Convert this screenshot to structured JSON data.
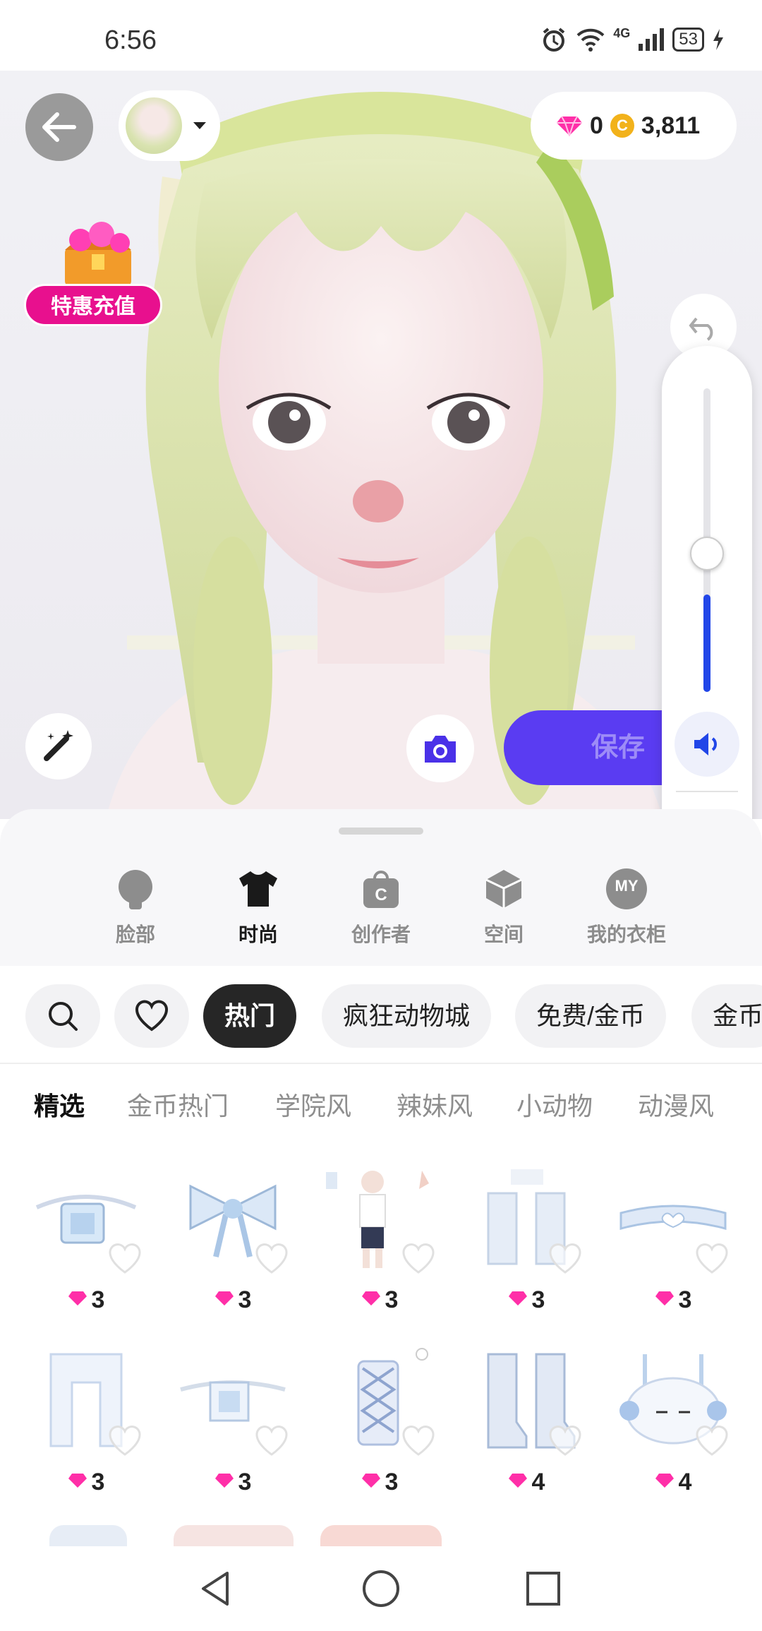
{
  "status_bar": {
    "time": "6:56",
    "network": "4G",
    "battery": "53"
  },
  "header": {
    "gems": "0",
    "coins": "3,811"
  },
  "promo": {
    "label": "特惠充值"
  },
  "actions": {
    "save_label": "保存"
  },
  "categories": [
    {
      "label": "脸部",
      "icon": "face-icon",
      "active": false
    },
    {
      "label": "时尚",
      "icon": "tshirt-icon",
      "active": true
    },
    {
      "label": "创作者",
      "icon": "creator-bag-icon",
      "active": false
    },
    {
      "label": "空间",
      "icon": "space-cube-icon",
      "active": false
    },
    {
      "label": "我的衣柜",
      "icon": "my-closet-icon",
      "active": false
    }
  ],
  "closet_icon_text": "MY",
  "filter_chips": [
    "热门",
    "疯狂动物城",
    "免费/金币",
    "金币"
  ],
  "sub_tabs": [
    "精选",
    "金币热门",
    "学院风",
    "辣妹风",
    "小动物",
    "动漫风"
  ],
  "items": [
    {
      "name": "lace-choker",
      "price": "3"
    },
    {
      "name": "blue-bow",
      "price": "3"
    },
    {
      "name": "full-outfit-set",
      "price": "3"
    },
    {
      "name": "white-leg-warmers",
      "price": "3"
    },
    {
      "name": "heart-choker",
      "price": "3"
    },
    {
      "name": "white-ruffle-top",
      "price": "3"
    },
    {
      "name": "frill-choker",
      "price": "3"
    },
    {
      "name": "lace-up-corset",
      "price": "3"
    },
    {
      "name": "white-boots",
      "price": "4"
    },
    {
      "name": "bunny-earmuffs",
      "price": "4"
    }
  ],
  "colors": {
    "accent": "#5a3cf2",
    "gem": "#ff2fa8",
    "coin": "#f2b21b",
    "promo": "#e8108e"
  }
}
